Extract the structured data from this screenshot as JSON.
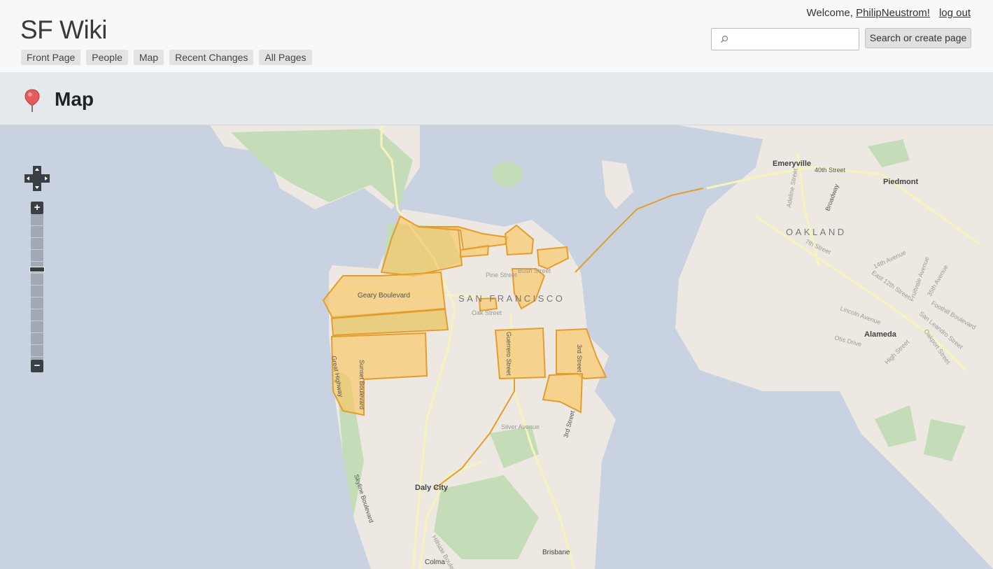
{
  "header": {
    "site_title": "SF Wiki",
    "nav": [
      "Front Page",
      "People",
      "Map",
      "Recent Changes",
      "All Pages"
    ],
    "welcome_prefix": "Welcome, ",
    "username": "PhilipNeustrom!",
    "logout": "log out",
    "search_placeholder": "",
    "search_button": "Search or create page"
  },
  "page": {
    "title": "Map",
    "icon": "map-pin-icon"
  },
  "map": {
    "labels": {
      "city": "SAN FRANCISCO",
      "oakland": "OAKLAND",
      "emeryville": "Emeryville",
      "piedmont": "Piedmont",
      "alameda": "Alameda",
      "daly_city": "Daly City",
      "brisbane": "Brisbane",
      "colma": "Colma",
      "geary": "Geary Boulevard",
      "sunset": "Sunset Boulevard",
      "great_highway": "Great Highway",
      "skyline": "Skyline Boulevard",
      "guerrero": "Guerrero Street",
      "third": "3rd Street",
      "third2": "3rd Street",
      "pine": "Pine Street",
      "bush": "Bush Street",
      "oak": "Oak Street",
      "silver": "Silver Avenue",
      "fortieth": "40th Street",
      "broadway": "Broadway",
      "seventh": "7th Street",
      "lincoln": "Lincoln Avenue",
      "otis": "Otis Drive",
      "high": "High Street",
      "east12": "East 12th Street",
      "fourteenth": "14th Avenue",
      "fruitvale": "Fruitvale Avenue",
      "thirtyfifth": "35th Avenue",
      "foothill": "Foothill Boulevard",
      "san_leandro": "San Leandro Street",
      "oakport": "Oakport Street",
      "hillside": "Hillside Boulevard",
      "adeline": "Adeline Street"
    },
    "colors": {
      "water": "#c8d2e0",
      "land": "#ede9e2",
      "park": "#c5dcb8",
      "road": "#fbfbd0",
      "polygon_fill": "#f8c86a",
      "polygon_stroke": "#e39d2e"
    },
    "controls": {
      "zoom_in": "+",
      "zoom_out": "−"
    }
  }
}
